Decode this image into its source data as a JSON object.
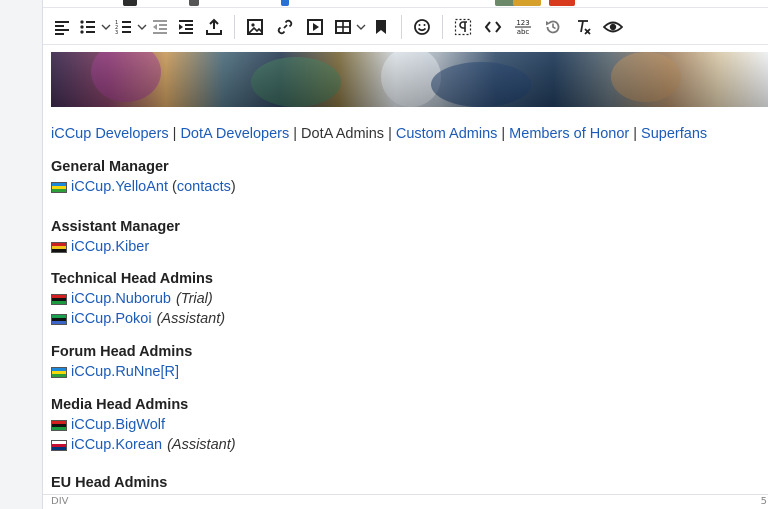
{
  "toolbar": {
    "buttons": [
      {
        "name": "align-left-icon"
      },
      {
        "name": "bullet-list-icon"
      },
      {
        "name": "numbered-list-icon"
      },
      {
        "name": "outdent-icon"
      },
      {
        "name": "indent-icon"
      },
      {
        "name": "upload-icon"
      },
      {
        "name": "image-icon"
      },
      {
        "name": "link-icon"
      },
      {
        "name": "media-icon"
      },
      {
        "name": "table-icon"
      },
      {
        "name": "bookmark-icon"
      },
      {
        "name": "emoji-icon"
      },
      {
        "name": "show-blocks-icon"
      },
      {
        "name": "code-icon"
      },
      {
        "name": "spellcheck-icon"
      },
      {
        "name": "history-icon"
      },
      {
        "name": "clear-format-icon"
      },
      {
        "name": "preview-icon"
      }
    ],
    "spellcheck_top": "123",
    "spellcheck_bottom": "abc"
  },
  "nav": {
    "items": [
      {
        "label": "iCCup Developers",
        "link": true
      },
      {
        "label": "DotA Developers",
        "link": true
      },
      {
        "label": "DotA Admins",
        "link": false
      },
      {
        "label": "Custom Admins",
        "link": true
      },
      {
        "label": "Members of Honor",
        "link": true
      },
      {
        "label": "Superfans",
        "link": true
      }
    ]
  },
  "sections": [
    {
      "title": "General Manager",
      "rows": [
        {
          "flag": [
            "#1e88d8",
            "#f5d90a",
            "#2e9e3a"
          ],
          "name": "iCCup.YelloAnt",
          "note": "",
          "extra_open": "(",
          "extra_link": "contacts",
          "extra_close": ")"
        }
      ]
    },
    {
      "title": "Assistant Manager",
      "rows": [
        {
          "flag": [
            "#cc1f1f",
            "#f0c419",
            "#111111"
          ],
          "name": "iCCup.Kiber",
          "note": ""
        }
      ]
    },
    {
      "title": "Technical Head Admins",
      "rows": [
        {
          "flag": [
            "#d21f1f",
            "#111111",
            "#1c9a3f"
          ],
          "name": "iCCup.Nuborub",
          "note": "(Trial)"
        },
        {
          "flag": [
            "#1aa150",
            "#111111",
            "#3a64c8"
          ],
          "name": "iCCup.Pokoi",
          "note": "(Assistant)"
        }
      ]
    },
    {
      "title": "Forum Head Admins",
      "rows": [
        {
          "flag": [
            "#1e88d8",
            "#f5d90a",
            "#2e9e3a"
          ],
          "name": "iCCup.RuNne[R]",
          "note": ""
        }
      ]
    },
    {
      "title": "Media Head Admins",
      "rows": [
        {
          "flag": [
            "#d21f1f",
            "#111111",
            "#1c9a3f"
          ],
          "name": "iCCup.BigWolf",
          "note": ""
        },
        {
          "flag": [
            "#ffffff",
            "#c60c30",
            "#003478"
          ],
          "name": "iCCup.Korean",
          "note": "(Assistant)"
        }
      ]
    },
    {
      "title": "EU Head Admins",
      "rows": []
    }
  ],
  "status": {
    "path": "DIV",
    "count": "5"
  },
  "colors": {
    "link": "#1c5bb8",
    "text": "#222222"
  }
}
